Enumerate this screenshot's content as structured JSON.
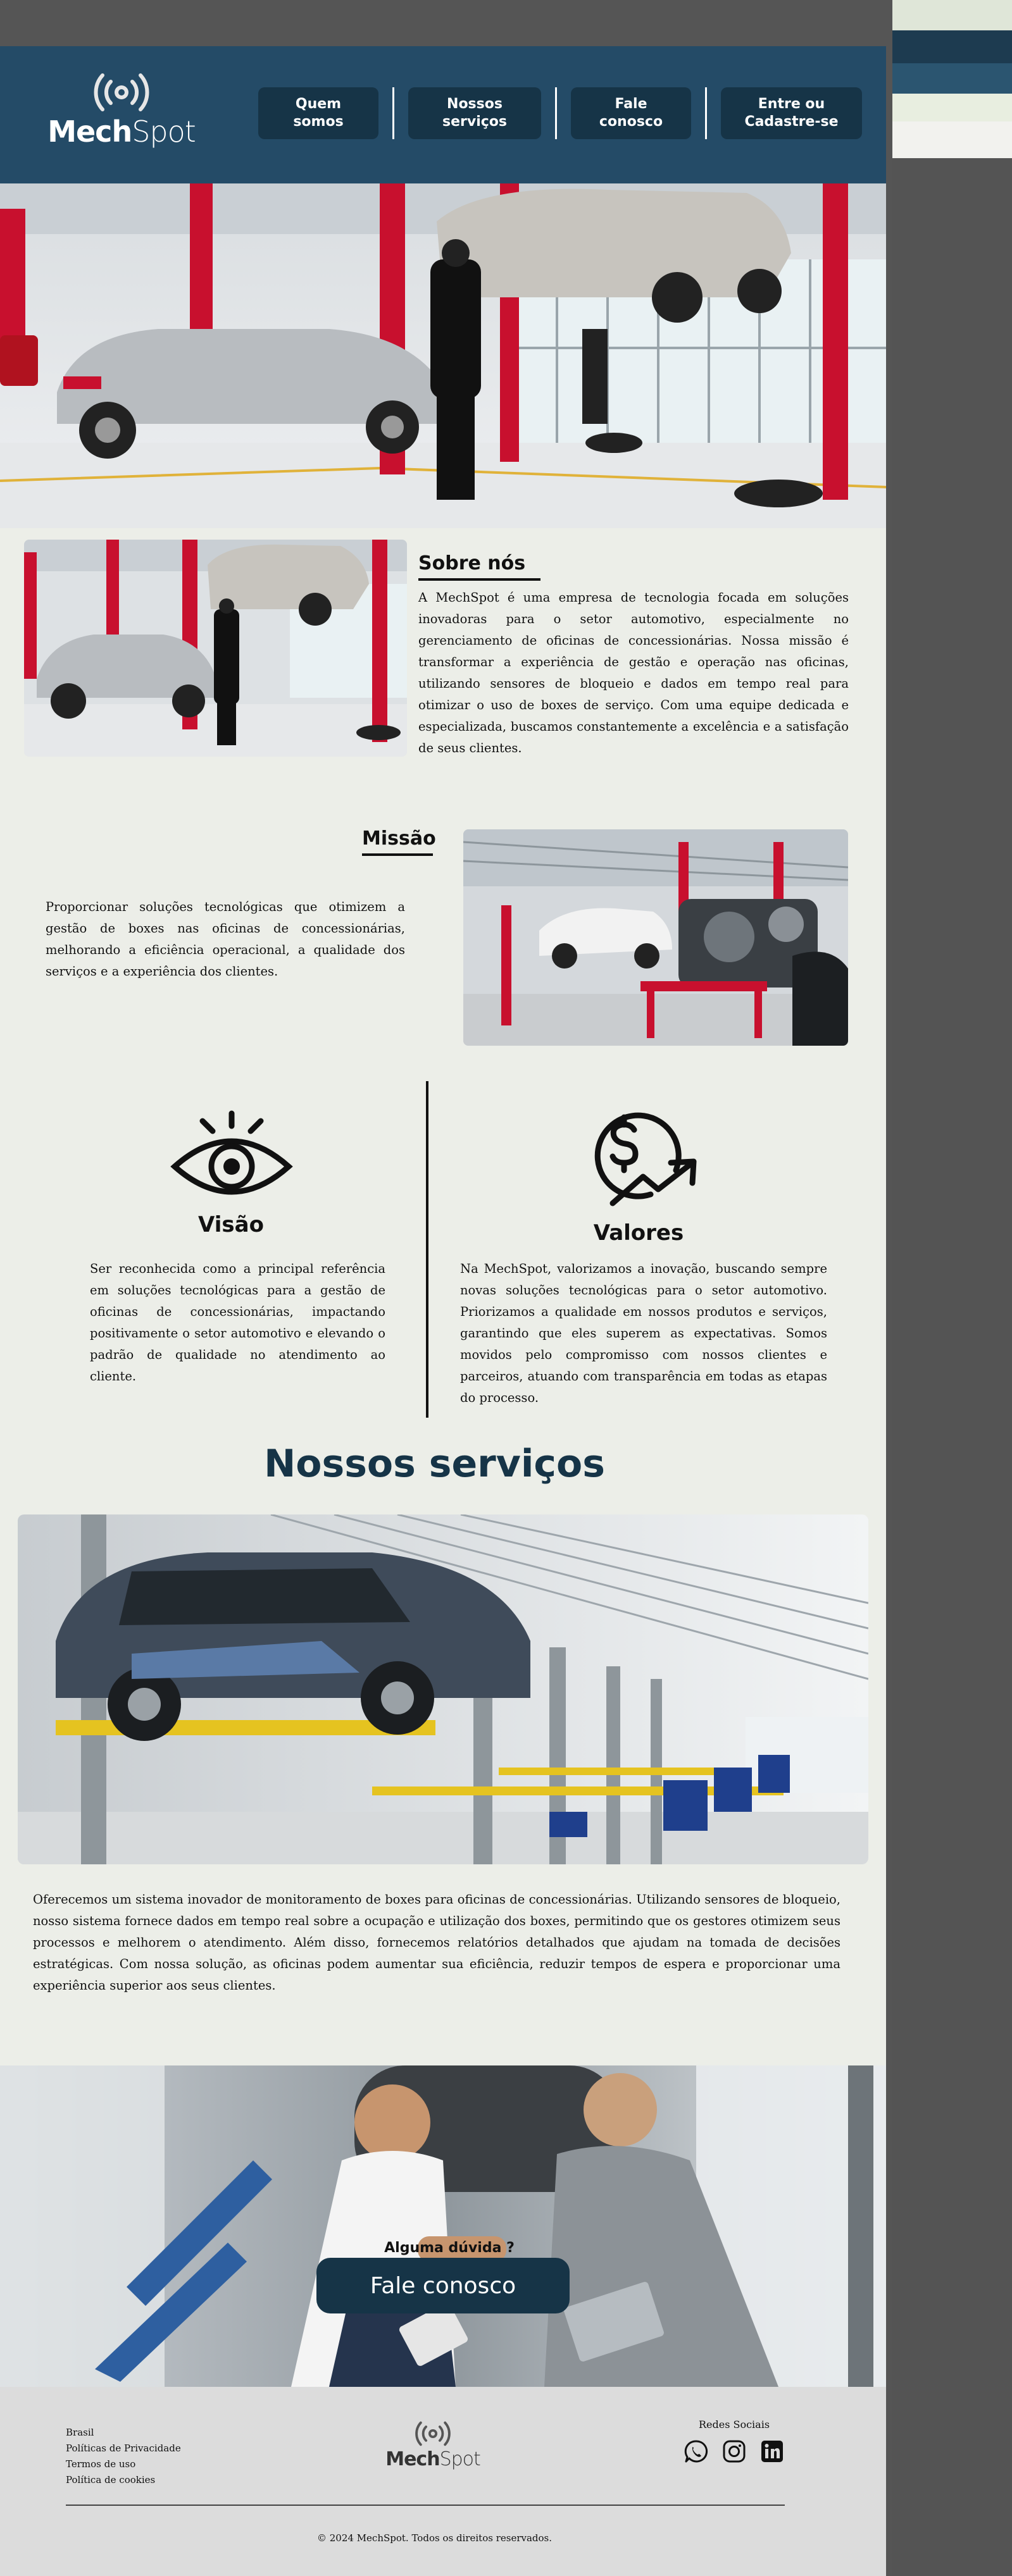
{
  "brand": {
    "name_bold": "Mech",
    "name_light": "Spot"
  },
  "nav": {
    "items": [
      {
        "label_line1": "Quem",
        "label_line2": "somos"
      },
      {
        "label_line1": "Nossos",
        "label_line2": "serviços"
      },
      {
        "label_line1": "Fale",
        "label_line2": "conosco"
      },
      {
        "label_line1": "Entre ou",
        "label_line2": "Cadastre-se"
      }
    ]
  },
  "about": {
    "title": "Sobre nós",
    "text": "A MechSpot é uma empresa de tecnologia focada em soluções inovadoras para o setor automotivo, especialmente no gerenciamento de oficinas de concessionárias. Nossa missão é transformar a experiência de gestão e operação nas oficinas, utilizando sensores de bloqueio e dados em tempo real para otimizar o uso de boxes de serviço. Com uma equipe dedicada e especializada, buscamos constantemente a excelência e a satisfação de seus clientes."
  },
  "mission": {
    "title": "Missão",
    "text": "Proporcionar soluções tecnológicas que otimizem a gestão de boxes nas oficinas de concessionárias, melhorando a eficiência operacional, a qualidade dos serviços e a experiência dos clientes."
  },
  "vision": {
    "title": "Visão",
    "icon": "eye-icon",
    "text": "Ser reconhecida como a principal referência em soluções tecnológicas para a gestão de oficinas de concessionárias, impactando positivamente o setor automotivo e elevando o padrão de qualidade no atendimento ao cliente."
  },
  "values": {
    "title": "Valores",
    "icon": "dollar-growth-icon",
    "text": "Na MechSpot, valorizamos a inovação, buscando sempre novas soluções tecnológicas para o setor automotivo. Priorizamos a qualidade em nossos produtos e serviços, garantindo que eles superem as expectativas. Somos movidos pelo compromisso com nossos clientes e parceiros, atuando com transparência em todas as etapas do processo."
  },
  "services": {
    "title": "Nossos serviços",
    "text": "Oferecemos um sistema inovador de monitoramento de boxes para oficinas de concessionárias. Utilizando sensores de bloqueio, nosso sistema fornece dados em tempo real sobre a ocupação e utilização dos boxes, permitindo que os gestores otimizem seus processos e melhorem o atendimento. Além disso, fornecemos relatórios detalhados que ajudam na tomada de decisões estratégicas. Com nossa solução, as oficinas podem aumentar sua eficiência, reduzir tempos de espera e proporcionar uma experiência superior aos seus clientes."
  },
  "cta": {
    "question": "Alguma dúvida ?",
    "button": "Fale conosco"
  },
  "footer": {
    "links": [
      "Brasil",
      "Políticas de Privacidade",
      "Termos de uso",
      "Política de cookies"
    ],
    "social_title": "Redes Sociais",
    "social_icons": [
      "whatsapp-icon",
      "instagram-icon",
      "linkedin-icon"
    ],
    "copyright": "© 2024 MechSpot. Todos os direitos reservados."
  },
  "colors": {
    "header_bg": "#244b67",
    "nav_button_bg": "#163447",
    "page_bg": "#eceee8",
    "footer_bg": "#dcdcdc",
    "accent_red": "#c8102e"
  }
}
